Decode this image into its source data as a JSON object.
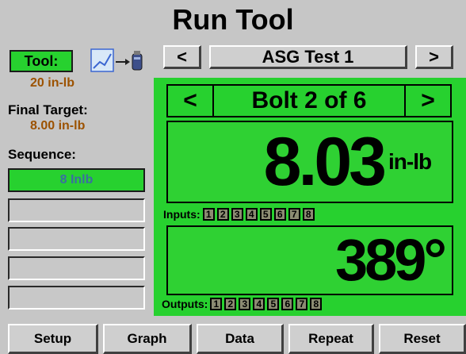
{
  "title": "Run Tool",
  "test_nav": {
    "prev": "<",
    "name": "ASG Test 1",
    "next": ">"
  },
  "tool": {
    "button_label": "Tool:",
    "value": "20 in-lb"
  },
  "final_target": {
    "label": "Final Target:",
    "value": "8.00 in-lb"
  },
  "sequence": {
    "label": "Sequence:",
    "items": [
      "8 Inlb",
      "",
      "",
      "",
      ""
    ]
  },
  "bolt_nav": {
    "prev": "<",
    "label": "Bolt 2 of 6",
    "next": ">"
  },
  "torque": {
    "value": "8.03",
    "unit": "in-lb"
  },
  "inputs": {
    "label": "Inputs:",
    "channels": [
      "1",
      "2",
      "3",
      "4",
      "5",
      "6",
      "7",
      "8"
    ]
  },
  "angle": {
    "value": "389°"
  },
  "outputs": {
    "label": "Outputs:",
    "channels": [
      "1",
      "2",
      "3",
      "4",
      "5",
      "6",
      "7",
      "8"
    ]
  },
  "bottom_buttons": [
    "Setup",
    "Graph",
    "Data",
    "Repeat",
    "Reset"
  ],
  "colors": {
    "panel_green": "#27d12f",
    "button_grey": "#cfcfcf",
    "background": "#c6c6c6",
    "label_orange": "#9c5200",
    "sequence_text": "#3a6fa0"
  },
  "icons": {
    "tool": "graph-arrow-tool-icon"
  }
}
